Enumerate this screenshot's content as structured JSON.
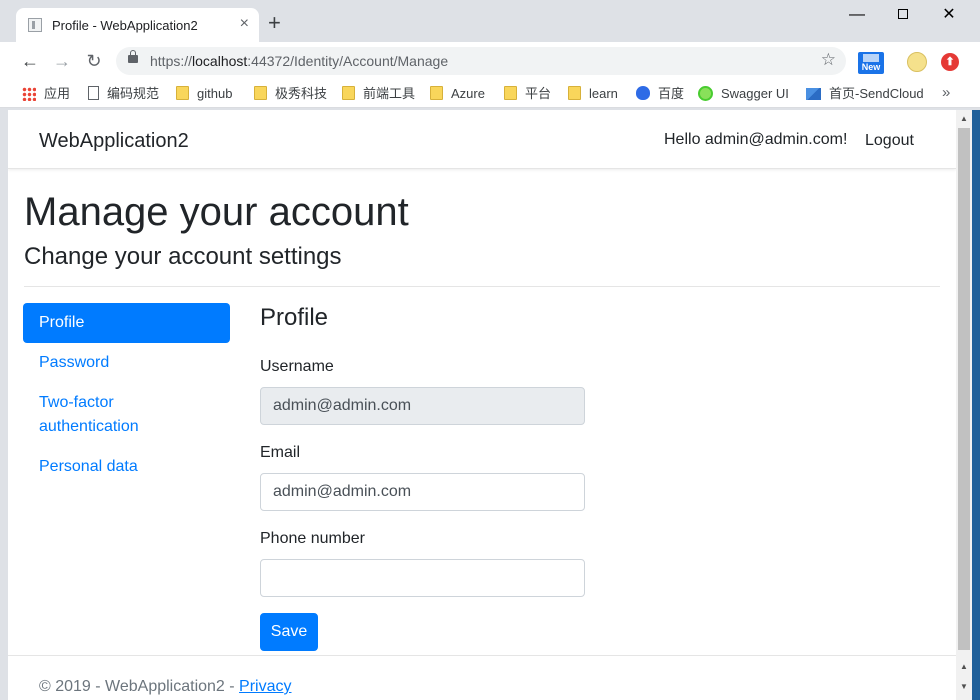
{
  "browser": {
    "tab_title": "Profile - WebApplication2",
    "tab_close": "×",
    "new_tab": "+",
    "window_controls": {
      "minimize": "—",
      "close": "✕"
    },
    "url_prefix": "https://",
    "url_host": "localhost",
    "url_rest": ":44372/Identity/Account/Manage",
    "ext_new_label": "New",
    "bookmarks": [
      {
        "label": "应用",
        "icon": "apps-icon"
      },
      {
        "label": "编码规范",
        "icon": "page-icon"
      },
      {
        "label": "github",
        "icon": "folder-icon"
      },
      {
        "label": "极秀科技",
        "icon": "folder-icon"
      },
      {
        "label": "前端工具",
        "icon": "folder-icon"
      },
      {
        "label": "Azure",
        "icon": "folder-icon"
      },
      {
        "label": "平台",
        "icon": "folder-icon"
      },
      {
        "label": "learn",
        "icon": "folder-icon"
      },
      {
        "label": "百度",
        "icon": "baidu-icon"
      },
      {
        "label": "Swagger UI",
        "icon": "swagger-icon"
      },
      {
        "label": "首页-SendCloud",
        "icon": "sendcloud-icon"
      }
    ],
    "bookmarks_more": "»"
  },
  "navbar": {
    "brand": "WebApplication2",
    "hello": "Hello admin@admin.com!",
    "logout": "Logout"
  },
  "page": {
    "title": "Manage your account",
    "subtitle": "Change your account settings"
  },
  "sidebar": {
    "items": [
      {
        "label": "Profile",
        "active": true
      },
      {
        "label": "Password",
        "active": false
      },
      {
        "label": "Two-factor authentication",
        "active": false
      },
      {
        "label": "Personal data",
        "active": false
      }
    ]
  },
  "profile": {
    "heading": "Profile",
    "username_label": "Username",
    "username_value": "admin@admin.com",
    "email_label": "Email",
    "email_value": "admin@admin.com",
    "phone_label": "Phone number",
    "phone_value": "",
    "save_label": "Save"
  },
  "footer": {
    "text": "© 2019 - WebApplication2 - ",
    "privacy": "Privacy"
  },
  "colors": {
    "primary": "#007bff",
    "text": "#212529",
    "readonly_bg": "#e9ecef"
  }
}
